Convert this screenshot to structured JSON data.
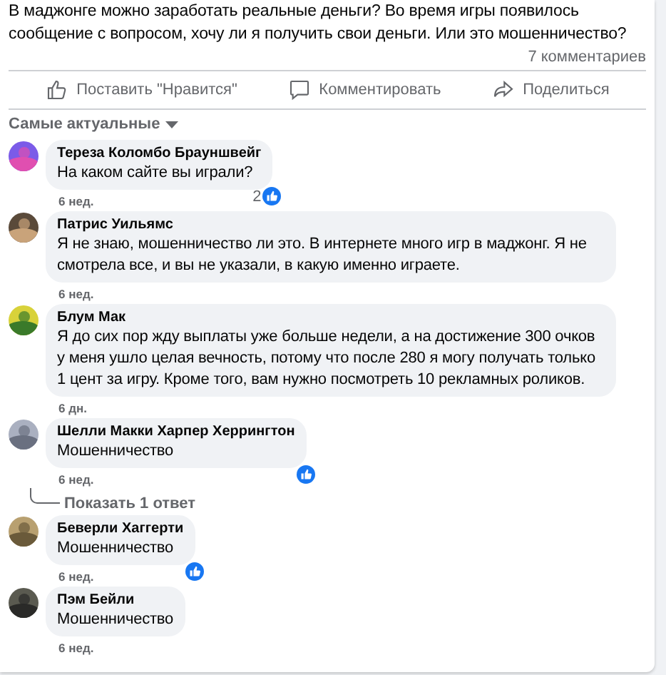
{
  "post": {
    "text": "В маджонге можно заработать реальные деньги? Во время игры появилось сообщение с вопросом, хочу ли я получить свои деньги. Или это мошенничество?",
    "comment_count": "7 комментариев"
  },
  "actions": [
    {
      "kind": "like",
      "label": "Поставить \"Нравится\""
    },
    {
      "kind": "comment",
      "label": "Комментировать"
    },
    {
      "kind": "share",
      "label": "Поделиться"
    }
  ],
  "sort": {
    "label": "Самые актуальные"
  },
  "comments": [
    {
      "author": "Тереза Коломбо Брауншвейг",
      "text": "На каком сайте вы играли?",
      "time": "6 нед.",
      "liked": true,
      "reaction_count": "2"
    },
    {
      "author": "Патрис Уильямс",
      "text": "Я не знаю, мошенничество ли это. В интернете много игр в маджонг. Я не смотрела все, и вы не указали, в какую именно играете.",
      "time": "6 нед.",
      "liked": false
    },
    {
      "author": "Блум Мак",
      "text": "Я до сих пор жду выплаты уже больше недели, а на достижение 300 очков у меня ушло целая вечность, потому что после 280 я могу получать только 1 цент за игру. Кроме того, вам нужно посмотреть 10 рекламных роликов.",
      "time": "6 дн.",
      "liked": false
    },
    {
      "author": "Шелли Макки Харпер Херрингтон",
      "text": "Мошенничество",
      "time": "6 нед.",
      "liked": true,
      "replies_link": "Показать 1 ответ"
    },
    {
      "author": "Беверли Хаггерти",
      "text": "Мошенничество",
      "time": "6 нед.",
      "liked": true
    },
    {
      "author": "Пэм Бейли",
      "text": "Мошенничество",
      "time": "6 нед.",
      "liked": false
    }
  ]
}
